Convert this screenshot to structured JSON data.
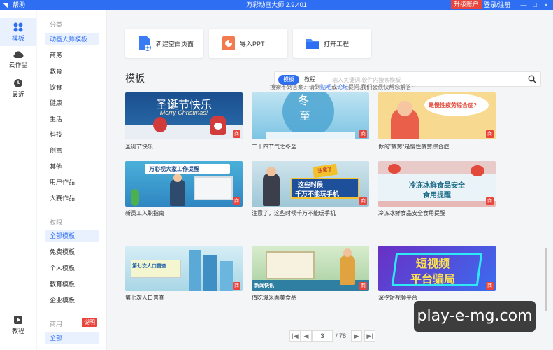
{
  "titlebar": {
    "help": "帮助",
    "title": "万彩动画大师 2.9.401",
    "upgrade": "升级账户",
    "login": "登录/注册",
    "min": "—",
    "max": "□",
    "close": "×"
  },
  "rail": {
    "templates": "模板",
    "cloud": "云作品",
    "recent": "最近",
    "tutorial": "教程"
  },
  "sidebar": {
    "category_group": "分类",
    "categories": [
      "动画大师模板",
      "商务",
      "教育",
      "饮食",
      "健康",
      "生活",
      "科技",
      "创意",
      "其他",
      "用户作品",
      "大赛作品"
    ],
    "permission_group": "权限",
    "permissions": [
      "全部模板",
      "免费模板",
      "个人模板",
      "教育模板",
      "企业模板"
    ],
    "commercial_group": "商用",
    "commercial_badge": "说明",
    "commercial_items": [
      "全部"
    ]
  },
  "actions": {
    "new_blank": "新建空白页面",
    "import_ppt": "导入PPT",
    "open_project": "打开工程"
  },
  "section_title": "模板",
  "search": {
    "tab_template": "模板",
    "tab_tutorial": "教程",
    "placeholder": "输入关键词,软件内搜索模板"
  },
  "search_hint": {
    "before": "搜索不到答案？请到",
    "link1": "贴吧",
    "mid": "或",
    "link2": "论坛",
    "after": "提问,我们会很快帮您解答~"
  },
  "tiles": [
    {
      "label": "圣诞节快乐",
      "art_title": "圣诞节快乐",
      "art_sub": "Merry Christmas!"
    },
    {
      "label": "二十四节气之冬至",
      "art_title": "冬",
      "art_sub": "至"
    },
    {
      "label": "你的”疲劳“是慢性疲劳综合症",
      "art_title": "是慢性疲劳综合症?"
    },
    {
      "label": "新员工入职指南",
      "art_title": "万彩视大家工作提醒"
    },
    {
      "label": "注意了，这些时候千万不能玩手机",
      "art_title": "这些时候",
      "art_sub": "千万不能玩手机",
      "art_badge": "注意了"
    },
    {
      "label": "冷冻冰鲜食品安全食用提醒",
      "art_title": "冷冻冰鲜食品安全",
      "art_sub": "食用提醒"
    },
    {
      "label": "第七次人口普查",
      "art_title": "第七次人口普查"
    },
    {
      "label": "值吃爆米面美食品",
      "art_title": "新闻快讯"
    },
    {
      "label": "深挖短视频平台",
      "art_title": "短视频",
      "art_sub": "平台骗局"
    }
  ],
  "shop_badge": "商",
  "pager": {
    "current": "3",
    "total": "/ 78",
    "first": "|◀",
    "prev": "◀",
    "next": "▶",
    "last": "▶|"
  },
  "watermark": "play-e-mg.com",
  "colors": {
    "brand": "#2e6ef2",
    "red": "#e8453c"
  }
}
